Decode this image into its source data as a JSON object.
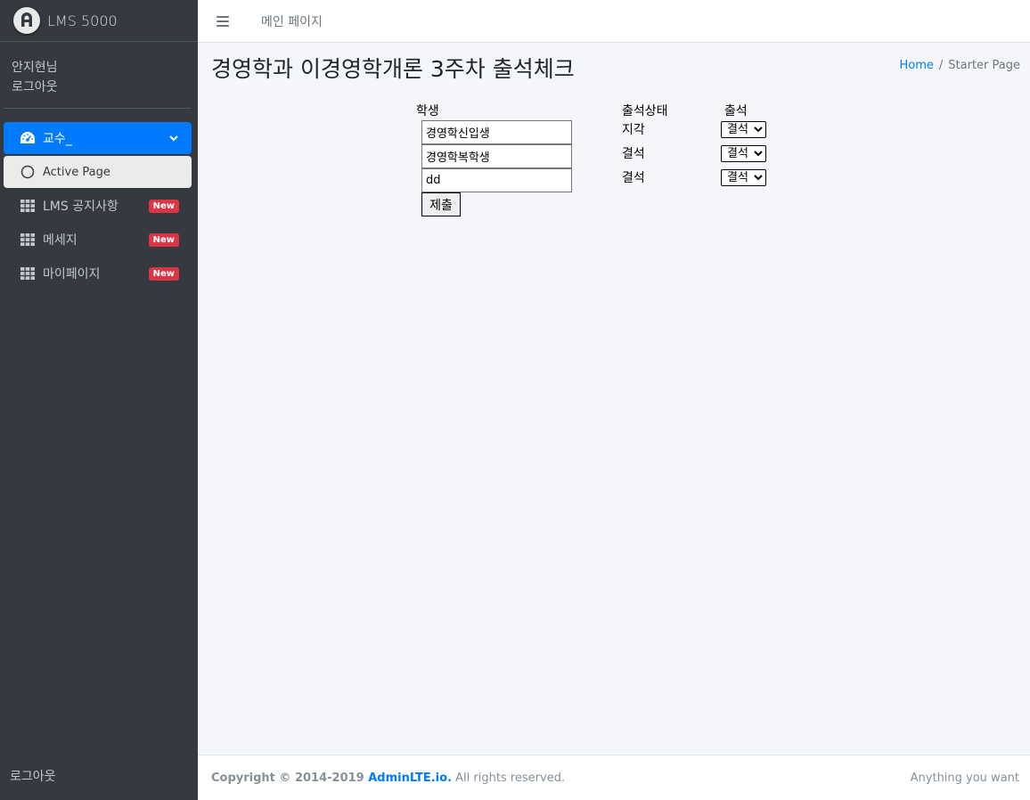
{
  "brand": {
    "name": "LMS 5000",
    "logo_icon": "adminlte-logo-icon"
  },
  "user": {
    "name": "안지현님",
    "logout": "로그아웃"
  },
  "sidebar": {
    "items": [
      {
        "label": "교수_",
        "icon": "tachometer-icon",
        "state": "expanded"
      },
      {
        "label": "Active Page",
        "icon": "circle-icon",
        "state": "active"
      },
      {
        "label": "LMS 공지사항",
        "icon": "grid-icon",
        "badge": "New"
      },
      {
        "label": "메세지",
        "icon": "grid-icon",
        "badge": "New"
      },
      {
        "label": "마이페이지",
        "icon": "grid-icon",
        "badge": "New"
      }
    ],
    "bottom_link": "로그아웃"
  },
  "navbar": {
    "main_link": "메인 페이지"
  },
  "page": {
    "title": "경영학과 이경영학개론 3주차 출석체크",
    "breadcrumb": {
      "home": "Home",
      "current": "Starter Page"
    }
  },
  "form": {
    "headers": {
      "student": "학생",
      "status": "출석상태",
      "attendance": "출석"
    },
    "rows": [
      {
        "student": "경영학신입생",
        "status": "지각",
        "attendance": "결석"
      },
      {
        "student": "경영학복학생",
        "status": "결석",
        "attendance": "결석"
      },
      {
        "student": "dd",
        "status": "결석",
        "attendance": "결석"
      }
    ],
    "submit_label": "제출"
  },
  "footer": {
    "copyright_prefix": "Copyright © 2014-2019 ",
    "copyright_link": "AdminLTE.io.",
    "copyright_suffix": " All rights reserved.",
    "right_text": "Anything you want"
  },
  "colors": {
    "sidebar_bg": "#343a40",
    "primary": "#007bff",
    "badge_danger": "#dc3545",
    "content_bg": "#f4f6f9"
  }
}
